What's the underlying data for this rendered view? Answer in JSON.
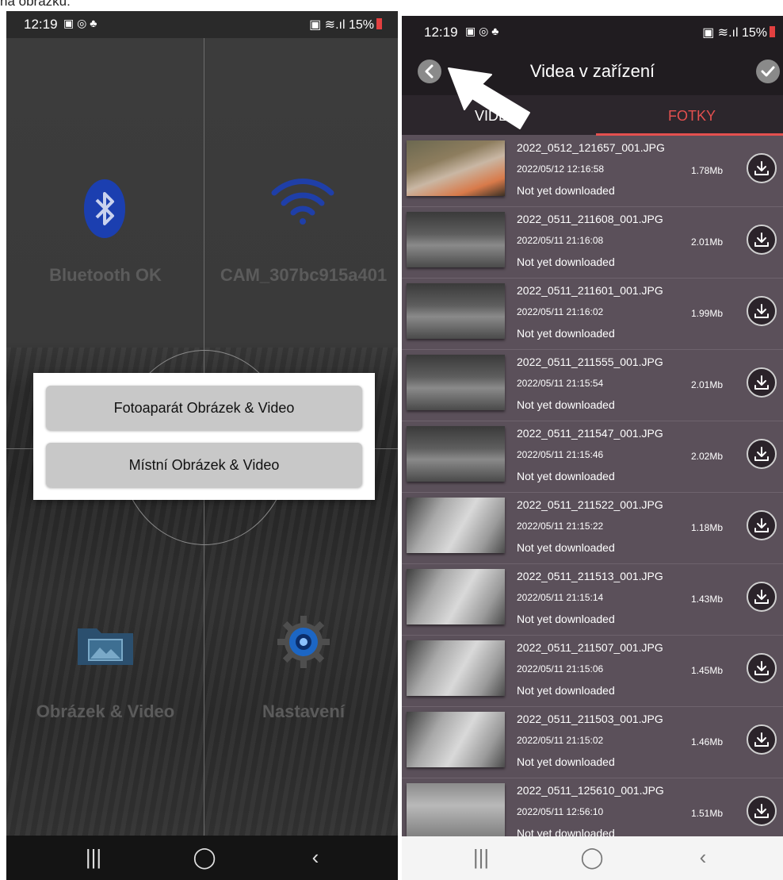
{
  "caption_fragment": "na obrázku:",
  "left_phone": {
    "status": {
      "time": "12:19",
      "battery": "15%"
    },
    "tiles": {
      "bluetooth_label": "Bluetooth OK",
      "wifi_label": "CAM_307bc915a401",
      "gallery_label": "Obrázek & Video",
      "settings_label": "Nastavení"
    },
    "dialog": {
      "camera_button": "Fotoaparát Obrázek & Video",
      "local_button": "Místní Obrázek & Video"
    },
    "nav": {
      "recent": "|||",
      "home": "◯",
      "back": "‹"
    }
  },
  "right_phone": {
    "status": {
      "time": "12:19",
      "battery": "15%"
    },
    "title": "Videa v zařízení",
    "tabs": {
      "videa": "VIDEA",
      "fotky": "FOTKY",
      "active": "fotky"
    },
    "files": [
      {
        "name": "2022_0512_121657_001.JPG",
        "date": "2022/05/12 12:16:58",
        "size": "1.78Mb",
        "status": "Not yet downloaded",
        "thumb": "color"
      },
      {
        "name": "2022_0511_211608_001.JPG",
        "date": "2022/05/11 21:16:08",
        "size": "2.01Mb",
        "status": "Not yet downloaded",
        "thumb": "dark"
      },
      {
        "name": "2022_0511_211601_001.JPG",
        "date": "2022/05/11 21:16:02",
        "size": "1.99Mb",
        "status": "Not yet downloaded",
        "thumb": "dark"
      },
      {
        "name": "2022_0511_211555_001.JPG",
        "date": "2022/05/11 21:15:54",
        "size": "2.01Mb",
        "status": "Not yet downloaded",
        "thumb": "dark"
      },
      {
        "name": "2022_0511_211547_001.JPG",
        "date": "2022/05/11 21:15:46",
        "size": "2.02Mb",
        "status": "Not yet downloaded",
        "thumb": "dark"
      },
      {
        "name": "2022_0511_211522_001.JPG",
        "date": "2022/05/11 21:15:22",
        "size": "1.18Mb",
        "status": "Not yet downloaded",
        "thumb": "bright"
      },
      {
        "name": "2022_0511_211513_001.JPG",
        "date": "2022/05/11 21:15:14",
        "size": "1.43Mb",
        "status": "Not yet downloaded",
        "thumb": "bright"
      },
      {
        "name": "2022_0511_211507_001.JPG",
        "date": "2022/05/11 21:15:06",
        "size": "1.45Mb",
        "status": "Not yet downloaded",
        "thumb": "bright"
      },
      {
        "name": "2022_0511_211503_001.JPG",
        "date": "2022/05/11 21:15:02",
        "size": "1.46Mb",
        "status": "Not yet downloaded",
        "thumb": "bright"
      },
      {
        "name": "2022_0511_125610_001.JPG",
        "date": "2022/05/11 12:56:10",
        "size": "1.51Mb",
        "status": "Not yet downloaded",
        "thumb": "gray"
      }
    ],
    "nav": {
      "recent": "|||",
      "home": "◯",
      "back": "‹"
    }
  },
  "colors": {
    "accent": "#e4504f",
    "list_bg": "#5b505a",
    "header_bg": "#201c20"
  }
}
